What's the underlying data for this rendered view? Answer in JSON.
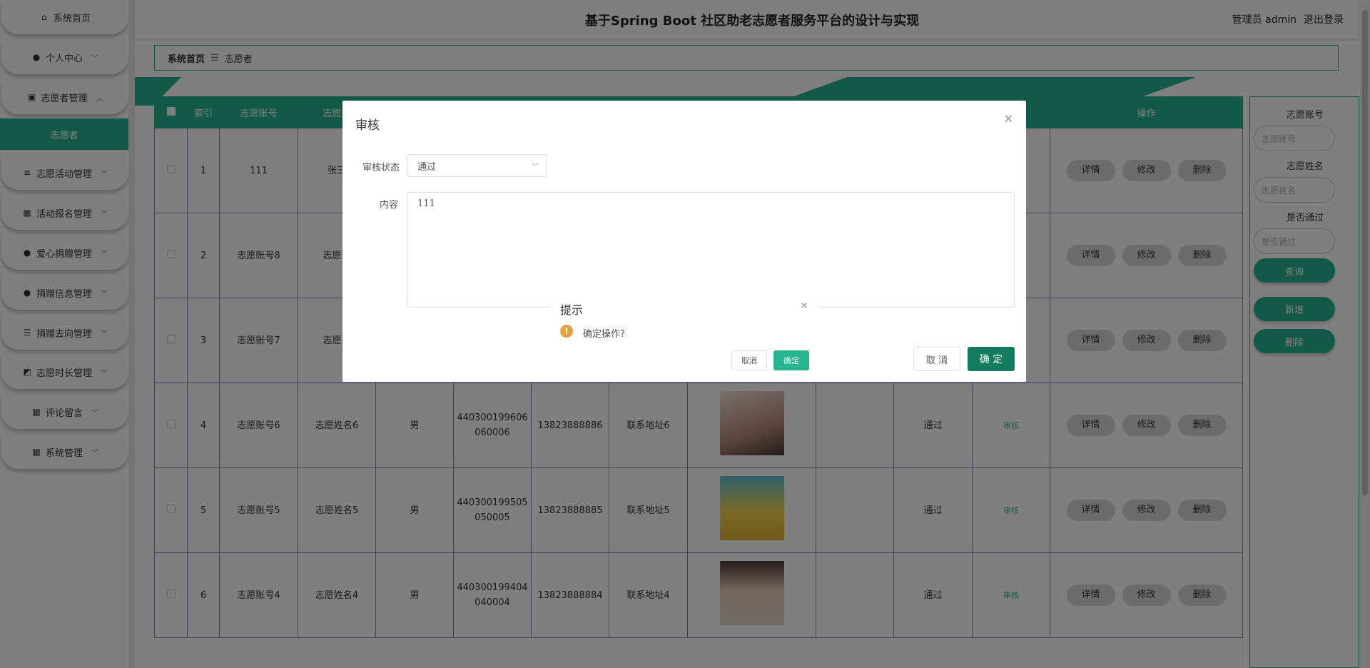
{
  "header": {
    "title": "基于Spring Boot 社区助老志愿者服务平台的设计与实现",
    "user": "管理员 admin",
    "logout": "退出登录"
  },
  "sidebar": {
    "items": [
      {
        "icon": "home-icon",
        "label": "系统首页",
        "chev": ""
      },
      {
        "icon": "user-icon",
        "label": "个人中心",
        "chev": "﹀"
      },
      {
        "icon": "clipboard-icon",
        "label": "志愿者管理",
        "chev": "︿"
      },
      {
        "icon": "sliders-icon",
        "label": "志愿活动管理",
        "chev": "﹀"
      },
      {
        "icon": "grid-icon",
        "label": "活动报名管理",
        "chev": "﹀"
      },
      {
        "icon": "user-icon",
        "label": "爱心捐赠管理",
        "chev": "﹀"
      },
      {
        "icon": "user-icon",
        "label": "捐赠信息管理",
        "chev": "﹀"
      },
      {
        "icon": "list-icon",
        "label": "捐赠去向管理",
        "chev": "﹀"
      },
      {
        "icon": "chart-icon",
        "label": "志愿时长管理",
        "chev": "﹀"
      },
      {
        "icon": "grid-icon",
        "label": "评论留言",
        "chev": "﹀"
      },
      {
        "icon": "grid-icon",
        "label": "系统管理",
        "chev": "﹀"
      }
    ],
    "sub": "志愿者"
  },
  "breadcrumb": {
    "home": "系统首页",
    "sep": "☰",
    "current": "志愿者"
  },
  "table": {
    "headers": [
      "索引",
      "志愿账号",
      "志愿姓",
      "",
      "",
      "",
      "",
      "",
      "",
      "",
      "",
      "操作"
    ],
    "rows": [
      {
        "idx": "1",
        "account": "111",
        "name": "张三",
        "sex": "",
        "id": "",
        "phone": "",
        "addr": "",
        "photo": "",
        "col9": "",
        "status": "",
        "audit": ""
      },
      {
        "idx": "2",
        "account": "志愿账号8",
        "name": "志愿姓",
        "sex": "",
        "id": "",
        "phone": "",
        "addr": "",
        "photo": "",
        "col9": "",
        "status": "",
        "audit": ""
      },
      {
        "idx": "3",
        "account": "志愿账号7",
        "name": "志愿姓",
        "sex": "",
        "id": "",
        "phone": "",
        "addr": "",
        "photo": "",
        "col9": "",
        "status": "",
        "audit": ""
      },
      {
        "idx": "4",
        "account": "志愿账号6",
        "name": "志愿姓名6",
        "sex": "男",
        "id1": "440300199606",
        "id2": "060006",
        "phone": "13823888886",
        "addr": "联系地址6",
        "photo": "p1",
        "col9": "",
        "status": "通过",
        "audit": "审核"
      },
      {
        "idx": "5",
        "account": "志愿账号5",
        "name": "志愿姓名5",
        "sex": "男",
        "id1": "440300199505",
        "id2": "050005",
        "phone": "13823888885",
        "addr": "联系地址5",
        "photo": "p2",
        "col9": "",
        "status": "通过",
        "audit": "审核"
      },
      {
        "idx": "6",
        "account": "志愿账号4",
        "name": "志愿姓名4",
        "sex": "男",
        "id1": "440300199404",
        "id2": "040004",
        "phone": "13823888884",
        "addr": "联系地址4",
        "photo": "p3",
        "col9": "",
        "status": "通过",
        "audit": "审核"
      }
    ],
    "ops": {
      "detail": "详情",
      "edit": "修改",
      "delete": "删除"
    }
  },
  "search": {
    "account_label": "志愿账号",
    "account_placeholder": "志愿账号",
    "name_label": "志愿姓名",
    "name_placeholder": "志愿姓名",
    "passed_label": "是否通过",
    "passed_placeholder": "是否通过",
    "query": "查询",
    "add": "新增",
    "delete": "删除"
  },
  "audit_dialog": {
    "title": "审核",
    "status_label": "审核状态",
    "status_value": "通过",
    "content_label": "内容",
    "content_value": "111",
    "cancel": "取 消",
    "ok": "确 定"
  },
  "confirm": {
    "title": "提示",
    "message": "确定操作?",
    "cancel": "取消",
    "ok": "确定"
  },
  "colors": {
    "accent": "#25b58f",
    "dark_accent": "#137b5e",
    "warning": "#e6a23c"
  }
}
